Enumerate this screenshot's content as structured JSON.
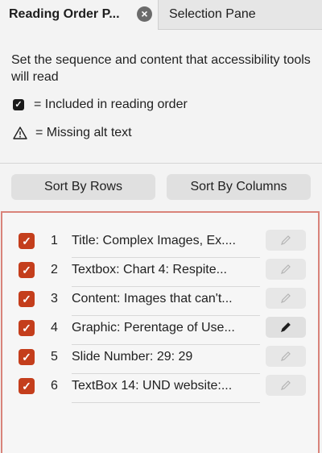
{
  "tabs": {
    "active_label": "Reading Order P...",
    "inactive_label": "Selection Pane",
    "close_icon": "close-icon"
  },
  "intro_text": "Set the sequence and content that accessibility tools will read",
  "legend": {
    "included_text": "= Included in reading order",
    "missing_text": "= Missing alt text"
  },
  "buttons": {
    "sort_rows": "Sort By Rows",
    "sort_columns": "Sort By Columns"
  },
  "items": [
    {
      "num": "1",
      "label": "Title: Complex Images, Ex....",
      "checked": true,
      "edit_active": false
    },
    {
      "num": "2",
      "label": "Textbox: Chart 4: Respite...",
      "checked": true,
      "edit_active": false
    },
    {
      "num": "3",
      "label": "Content: Images that can't...",
      "checked": true,
      "edit_active": false
    },
    {
      "num": "4",
      "label": "Graphic: Perentage of Use...",
      "checked": true,
      "edit_active": true
    },
    {
      "num": "5",
      "label": "Slide Number: 29: 29",
      "checked": true,
      "edit_active": false
    },
    {
      "num": "6",
      "label": "TextBox 14: UND website:...",
      "checked": true,
      "edit_active": false
    }
  ],
  "colors": {
    "checkbox": "#c43e1c",
    "list_border": "#d9837a"
  }
}
